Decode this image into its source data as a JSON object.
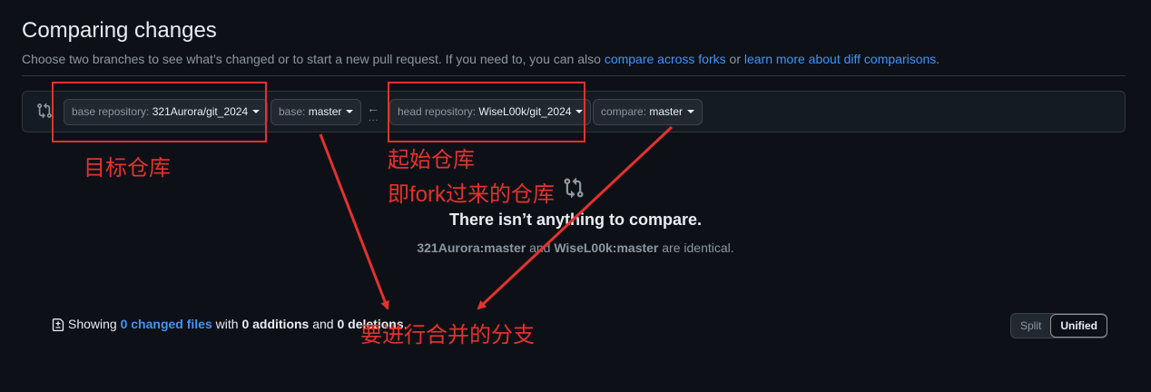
{
  "header": {
    "title": "Comparing changes",
    "subtitle_pre": "Choose two branches to see what’s changed or to start a new pull request. If you need to, you can also ",
    "link_forks": "compare across forks",
    "subtitle_mid": " or ",
    "link_learn": "learn more about diff comparisons",
    "subtitle_end": "."
  },
  "range": {
    "base_repo_label": "base repository: ",
    "base_repo_value": "321Aurora/git_2024",
    "base_label": "base: ",
    "base_value": "master",
    "arrow": "←",
    "dots": "...",
    "head_repo_label": "head repository: ",
    "head_repo_value": "WiseL00k/git_2024",
    "compare_label": "compare: ",
    "compare_value": "master"
  },
  "blankslate": {
    "title": "There isn’t anything to compare.",
    "base_ref": "321Aurora:master",
    "and": " and ",
    "head_ref": "WiseL00k:master",
    "identical": " are identical."
  },
  "toc": {
    "showing": "Showing ",
    "changed_files": "0 changed files",
    "with": " with ",
    "additions": "0 additions",
    "and": " and ",
    "deletions": "0 deletions",
    "end": "."
  },
  "view_toggle": {
    "split": "Split",
    "unified": "Unified"
  },
  "annotations": {
    "target_repo": "目标仓库",
    "source_repo_1": "起始仓库",
    "source_repo_2": "即fork过来的仓库",
    "branches": "要进行合并的分支",
    "color": "#e5322d"
  }
}
